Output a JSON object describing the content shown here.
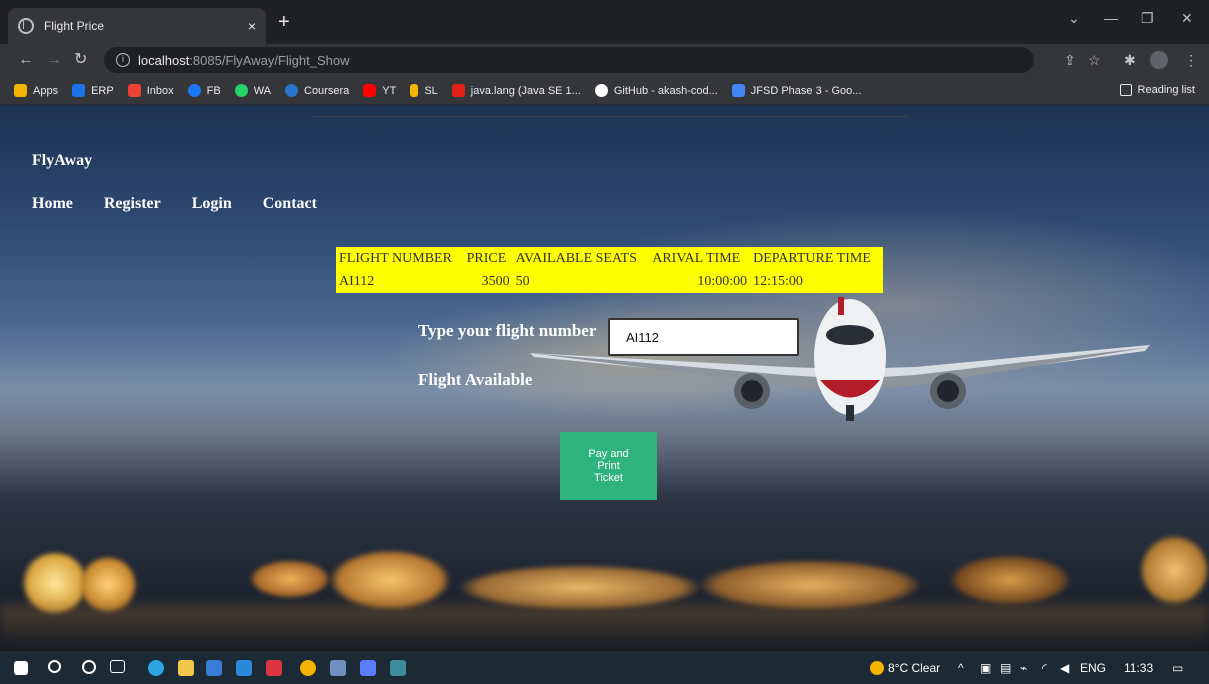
{
  "browser": {
    "tab_title": "Flight Price",
    "tab_close": "×",
    "new_tab": "+",
    "url_host": "localhost",
    "url_path": ":8085/FlyAway/Flight_Show",
    "win_minimize": "—",
    "win_restore": "❐",
    "win_close": "✕",
    "win_dropdown": "⌄",
    "bookmarks": [
      {
        "label": "Apps",
        "icon": "apps-grid-icon",
        "color": "#f4b400"
      },
      {
        "label": "ERP",
        "icon": "erp-icon",
        "color": "#1a73e8"
      },
      {
        "label": "Inbox",
        "icon": "gmail-icon",
        "color": "#ea4335"
      },
      {
        "label": "FB",
        "icon": "facebook-icon",
        "color": "#1877f2"
      },
      {
        "label": "WA",
        "icon": "whatsapp-icon",
        "color": "#25d366"
      },
      {
        "label": "Coursera",
        "icon": "coursera-icon",
        "color": "#2a73cc"
      },
      {
        "label": "YT",
        "icon": "youtube-icon",
        "color": "#ff0000"
      },
      {
        "label": "SL",
        "icon": "simplilearn-icon",
        "color": "#f4b400"
      },
      {
        "label": "java.lang (Java SE 1...",
        "icon": "oracle-icon",
        "color": "#e2231a"
      },
      {
        "label": "GitHub - akash-cod...",
        "icon": "github-icon",
        "color": "#ffffff"
      },
      {
        "label": "JFSD Phase 3 - Goo...",
        "icon": "google-docs-icon",
        "color": "#4285f4"
      }
    ],
    "reading_list": "Reading list"
  },
  "page": {
    "brand": "FlyAway",
    "nav": [
      "Home",
      "Register",
      "Login",
      "Contact"
    ],
    "table": {
      "headers": [
        "FLIGHT NUMBER",
        "PRICE",
        "AVAILABLE SEATS",
        "ARIVAL TIME",
        "DEPARTURE TIME"
      ],
      "row": [
        "AI112",
        "3500",
        "50",
        "10:00:00",
        "12:15:00"
      ],
      "background": "#ffff00"
    },
    "input_label": "Type your flight number",
    "input_value": "AI112",
    "status_text": "Flight Available",
    "pay_button": "Pay and Print Ticket",
    "pay_button_color": "#2fb37c"
  },
  "taskbar": {
    "weather": "8°C  Clear",
    "language": "ENG",
    "time": "11:33"
  }
}
